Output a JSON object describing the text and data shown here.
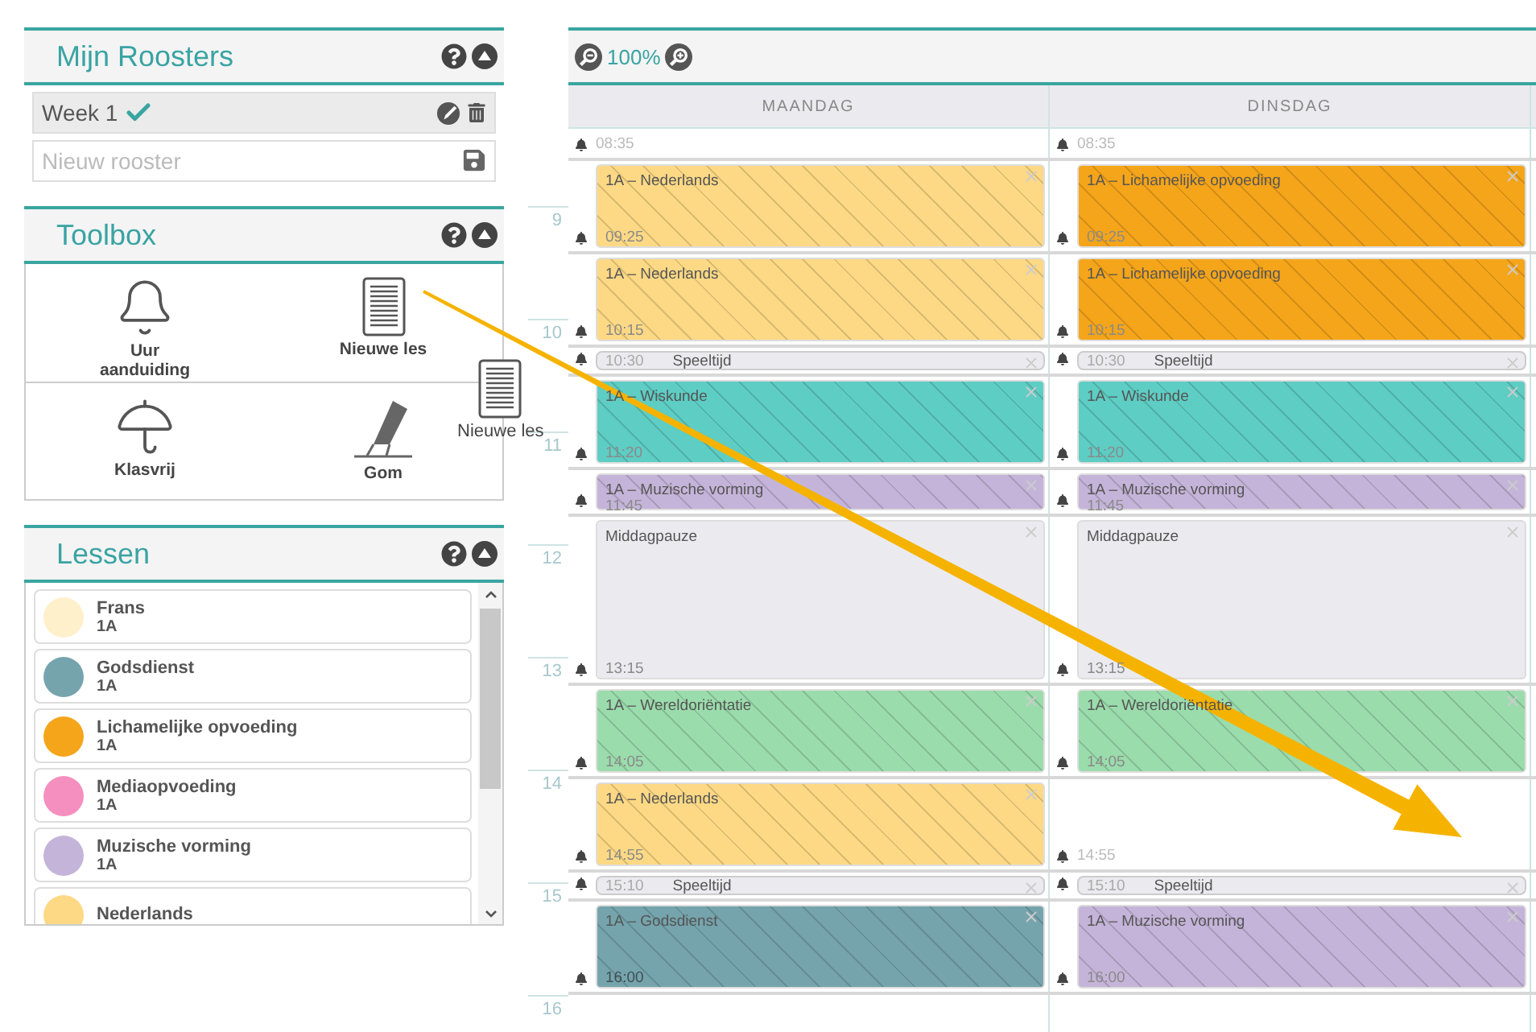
{
  "sidebar": {
    "roosters": {
      "title": "Mijn Roosters",
      "items": [
        {
          "name": "Week 1",
          "active": true
        }
      ],
      "placeholder": "Nieuw rooster"
    },
    "toolbox": {
      "title": "Toolbox",
      "tools": [
        {
          "kind": "bell",
          "label": "Uur aanduiding"
        },
        {
          "kind": "document",
          "label": "Nieuwe les"
        },
        {
          "kind": "umbrella",
          "label": "Klasvrij"
        },
        {
          "kind": "eraser",
          "label": "Gom"
        }
      ]
    },
    "lessons": {
      "title": "Lessen",
      "items": [
        {
          "name": "Frans",
          "group": "1A",
          "color": "#fff0cc"
        },
        {
          "name": "Godsdienst",
          "group": "1A",
          "color": "#75a4ad"
        },
        {
          "name": "Lichamelijke opvoeding",
          "group": "1A",
          "color": "#f5a51a"
        },
        {
          "name": "Mediaopvoeding",
          "group": "1A",
          "color": "#f58fbf"
        },
        {
          "name": "Muzische vorming",
          "group": "1A",
          "color": "#c5b4d9"
        },
        {
          "name": "Nederlands",
          "color": "#fdd985"
        }
      ]
    }
  },
  "drag_ghost": {
    "label": "Nieuwe les"
  },
  "calendar": {
    "zoom": "100%",
    "days": [
      "MAANDAG",
      "DINSDAG"
    ],
    "hours": [
      "9",
      "10",
      "11",
      "12",
      "13",
      "14",
      "15",
      "16"
    ],
    "slots": [
      {
        "cells": [
          {
            "kind": "start",
            "time": "08:35"
          },
          {
            "kind": "start",
            "time": "08:35"
          }
        ]
      },
      {
        "cells": [
          {
            "kind": "lesson",
            "title": "1A – Nederlands",
            "color": "#fdd985",
            "time": "09:25"
          },
          {
            "kind": "lesson",
            "title": "1A – Lichamelijke opvoeding",
            "color": "#f5a51a",
            "time": "09:25"
          }
        ]
      },
      {
        "cells": [
          {
            "kind": "lesson",
            "title": "1A – Nederlands",
            "color": "#fdd985",
            "time": "10:15"
          },
          {
            "kind": "lesson",
            "title": "1A – Lichamelijke opvoeding",
            "color": "#f5a51a",
            "time": "10:15"
          }
        ]
      },
      {
        "cells": [
          {
            "kind": "break",
            "title": "Speeltijd",
            "time": "10:30"
          },
          {
            "kind": "break",
            "title": "Speeltijd",
            "time": "10:30"
          }
        ]
      },
      {
        "cells": [
          {
            "kind": "lesson",
            "title": "1A – Wiskunde",
            "color": "#5ecdc4",
            "time": "11:20"
          },
          {
            "kind": "lesson",
            "title": "1A – Wiskunde",
            "color": "#5ecdc4",
            "time": "11:20"
          }
        ]
      },
      {
        "cells": [
          {
            "kind": "lesson",
            "title": "1A – Muzische vorming",
            "color": "#c5b4d9",
            "time": "11:45"
          },
          {
            "kind": "lesson",
            "title": "1A – Muzische vorming",
            "color": "#c5b4d9",
            "time": "11:45"
          }
        ]
      },
      {
        "cells": [
          {
            "kind": "pause",
            "title": "Middagpauze",
            "color": "#ebeaef",
            "time": "13:15"
          },
          {
            "kind": "pause",
            "title": "Middagpauze",
            "color": "#ebeaef",
            "time": "13:15"
          }
        ]
      },
      {
        "cells": [
          {
            "kind": "lesson",
            "title": "1A – Wereldoriëntatie",
            "color": "#9bdcac",
            "time": "14:05"
          },
          {
            "kind": "lesson",
            "title": "1A – Wereldoriëntatie",
            "color": "#9bdcac",
            "time": "14:05"
          }
        ]
      },
      {
        "cells": [
          {
            "kind": "lesson",
            "title": "1A – Nederlands",
            "color": "#fdd985",
            "time": "14:55"
          },
          {
            "kind": "empty",
            "time": "14:55"
          }
        ]
      },
      {
        "cells": [
          {
            "kind": "break",
            "title": "Speeltijd",
            "time": "15:10"
          },
          {
            "kind": "break",
            "title": "Speeltijd",
            "time": "15:10"
          }
        ]
      },
      {
        "cells": [
          {
            "kind": "lesson",
            "title": "1A – Godsdienst",
            "color": "#75a4ad",
            "time": "16:00"
          },
          {
            "kind": "lesson",
            "title": "1A – Muzische vorming",
            "color": "#c5b4d9",
            "time": "16:00"
          }
        ]
      }
    ]
  }
}
